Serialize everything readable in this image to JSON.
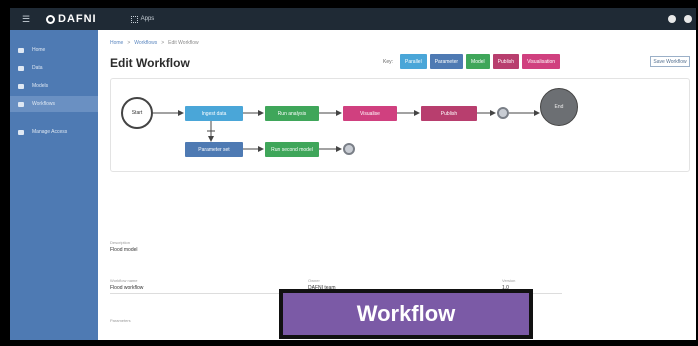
{
  "app": {
    "logo": "DAFNI",
    "apps_label": "Apps"
  },
  "sidebar": {
    "items": [
      {
        "label": "Home"
      },
      {
        "label": "Data"
      },
      {
        "label": "Models"
      },
      {
        "label": "Workflows"
      },
      {
        "label": "Manage Access"
      }
    ]
  },
  "breadcrumb": [
    "Home",
    ">",
    "Workflows",
    ">",
    "Edit Workflow"
  ],
  "page": {
    "title": "Edit Workflow",
    "save_label": "Save Workflow"
  },
  "legend": {
    "key_label": "Key:",
    "chips": [
      {
        "label": "Parallel",
        "color": "#4aa6d8"
      },
      {
        "label": "Parameter",
        "color": "#4e7ab3"
      },
      {
        "label": "Model",
        "color": "#3fa65a"
      },
      {
        "label": "Publish",
        "color": "#b83e6e"
      },
      {
        "label": "Visualisation",
        "color": "#d0407f"
      }
    ]
  },
  "workflow": {
    "start_label": "Start",
    "end_label": "End",
    "nodes": [
      {
        "label": "Ingest data",
        "color": "#4aa6d8"
      },
      {
        "label": "Run analysis",
        "color": "#3fa65a"
      },
      {
        "label": "Visualise",
        "color": "#d0407f"
      },
      {
        "label": "Publish",
        "color": "#b83e6e"
      },
      {
        "label": "Parameter set",
        "color": "#4e7ab3"
      },
      {
        "label": "Run second model",
        "color": "#3fa65a"
      }
    ]
  },
  "form": {
    "description": {
      "label": "Description",
      "value": "Flood model"
    },
    "workflow_name": {
      "label": "Workflow name",
      "value": "Flood workflow"
    },
    "owner": {
      "label": "Owner",
      "value": "DAFNI team"
    },
    "version": {
      "label": "Version",
      "value": "1.0"
    },
    "parameters": {
      "label": "Parameters",
      "value": ""
    }
  },
  "banner": {
    "label": "Workflow"
  }
}
